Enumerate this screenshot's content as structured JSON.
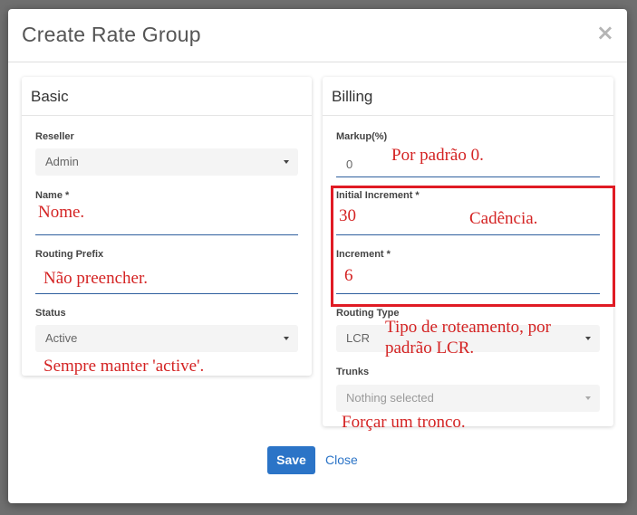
{
  "modal": {
    "title": "Create Rate Group",
    "close_symbol": "×"
  },
  "basic": {
    "title": "Basic",
    "reseller_label": "Reseller",
    "reseller_value": "Admin",
    "name_label": "Name *",
    "name_value": "",
    "routing_prefix_label": "Routing Prefix",
    "routing_prefix_value": "",
    "status_label": "Status",
    "status_value": "Active"
  },
  "billing": {
    "title": "Billing",
    "markup_label": "Markup(%)",
    "markup_value": "0",
    "initial_increment_label": "Initial Increment *",
    "initial_increment_value": "30",
    "increment_label": "Increment *",
    "increment_value": "6",
    "routing_type_label": "Routing Type",
    "routing_type_value": "LCR",
    "trunks_label": "Trunks",
    "trunks_placeholder": "Nothing selected"
  },
  "annotations": {
    "name": "Nome.",
    "routing_prefix": "Não preencher.",
    "status": "Sempre manter 'active'.",
    "markup": "Por padrão 0.",
    "increment": "Cadência.",
    "routing_type_line1": "Tipo de roteamento, por",
    "routing_type_line2": "padrão LCR.",
    "trunks": "Forçar um tronco."
  },
  "footer": {
    "save_label": "Save",
    "close_label": "Close"
  },
  "colors": {
    "primary": "#2b74c7",
    "annotation": "#d42323",
    "highlight_box": "#e01b24"
  }
}
